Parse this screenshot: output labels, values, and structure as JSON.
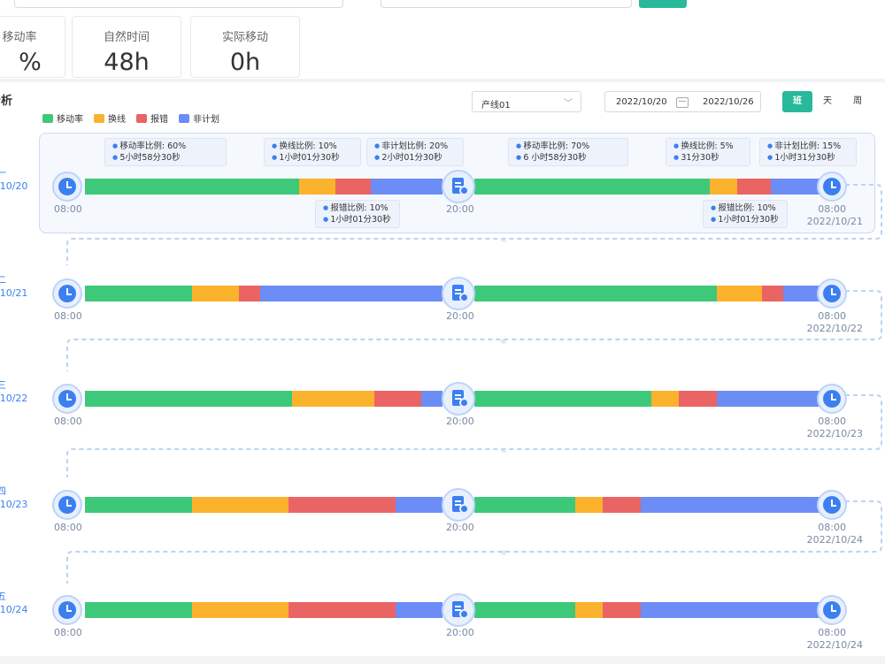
{
  "stats": [
    {
      "label": "移动率",
      "value": "%"
    },
    {
      "label": "自然时间",
      "value": "48h"
    },
    {
      "label": "实际移动",
      "value": "0h"
    }
  ],
  "section": {
    "title": "分析"
  },
  "legend": [
    {
      "label": "移动率",
      "color": "#3ec97a"
    },
    {
      "label": "换线",
      "color": "#fbb22c"
    },
    {
      "label": "报错",
      "color": "#ea6464"
    },
    {
      "label": "非计划",
      "color": "#6c8df5"
    }
  ],
  "filters": {
    "line_select": "产线01",
    "date_from": "2022/10/20",
    "date_to": "2022/10/26",
    "modes": [
      "班",
      "天",
      "周"
    ],
    "active_mode": "班"
  },
  "rows": [
    {
      "day_label": "一",
      "date_label": "/10/20",
      "start_time": "08:00",
      "mid_time": "20:00",
      "end_time": "08:00",
      "end_date": "2022/10/21",
      "left": [
        [
          "g",
          60
        ],
        [
          "y",
          10
        ],
        [
          "r",
          10
        ],
        [
          "b",
          20
        ]
      ],
      "right": [
        [
          "g",
          70
        ],
        [
          "y",
          8
        ],
        [
          "r",
          10
        ],
        [
          "b",
          15
        ]
      ]
    },
    {
      "day_label": "二",
      "date_label": "/10/21",
      "start_time": "08:00",
      "mid_time": "20:00",
      "end_time": "08:00",
      "end_date": "2022/10/22",
      "left": [
        [
          "g",
          30
        ],
        [
          "y",
          13
        ],
        [
          "r",
          6
        ],
        [
          "b",
          51
        ]
      ],
      "right": [
        [
          "g",
          70
        ],
        [
          "y",
          13
        ],
        [
          "r",
          6
        ],
        [
          "b",
          11
        ]
      ]
    },
    {
      "day_label": "三",
      "date_label": "/10/22",
      "start_time": "08:00",
      "mid_time": "20:00",
      "end_time": "08:00",
      "end_date": "2022/10/23",
      "left": [
        [
          "g",
          58
        ],
        [
          "y",
          23
        ],
        [
          "r",
          13
        ],
        [
          "b",
          6
        ]
      ],
      "right": [
        [
          "g",
          51
        ],
        [
          "y",
          8
        ],
        [
          "r",
          11
        ],
        [
          "b",
          30
        ]
      ]
    },
    {
      "day_label": "四",
      "date_label": "/10/23",
      "start_time": "08:00",
      "mid_time": "20:00",
      "end_time": "08:00",
      "end_date": "2022/10/24",
      "left": [
        [
          "g",
          30
        ],
        [
          "y",
          27
        ],
        [
          "r",
          30
        ],
        [
          "b",
          13
        ]
      ],
      "right": [
        [
          "g",
          29
        ],
        [
          "y",
          8
        ],
        [
          "r",
          11
        ],
        [
          "b",
          52
        ]
      ]
    },
    {
      "day_label": "五",
      "date_label": "/10/24",
      "start_time": "08:00",
      "mid_time": "20:00",
      "end_time": "08:00",
      "end_date": "2022/10/24",
      "left": [
        [
          "g",
          30
        ],
        [
          "y",
          27
        ],
        [
          "r",
          30
        ],
        [
          "b",
          13
        ]
      ],
      "right": [
        [
          "g",
          29
        ],
        [
          "y",
          8
        ],
        [
          "r",
          11
        ],
        [
          "b",
          52
        ]
      ]
    }
  ],
  "tooltips_top": [
    {
      "lines": [
        "移动率比例: 60%",
        "5小时58分30秒"
      ]
    },
    {
      "lines": [
        "换线比例: 10%",
        "1小时01分30秒"
      ]
    },
    {
      "lines": [
        "非计划比例: 20%",
        "2小时01分30秒"
      ]
    },
    {
      "lines": [
        "移动率比例: 70%",
        "6 小时58分30秒"
      ]
    },
    {
      "lines": [
        "换线比例: 5%",
        "31分30秒"
      ]
    },
    {
      "lines": [
        "非计划比例: 15%",
        "1小时31分30秒"
      ]
    }
  ],
  "tooltips_bottom": [
    {
      "lines": [
        "报错比例: 10%",
        "1小时01分30秒"
      ]
    },
    {
      "lines": [
        "报错比例: 10%",
        "1小时01分30秒"
      ]
    }
  ]
}
